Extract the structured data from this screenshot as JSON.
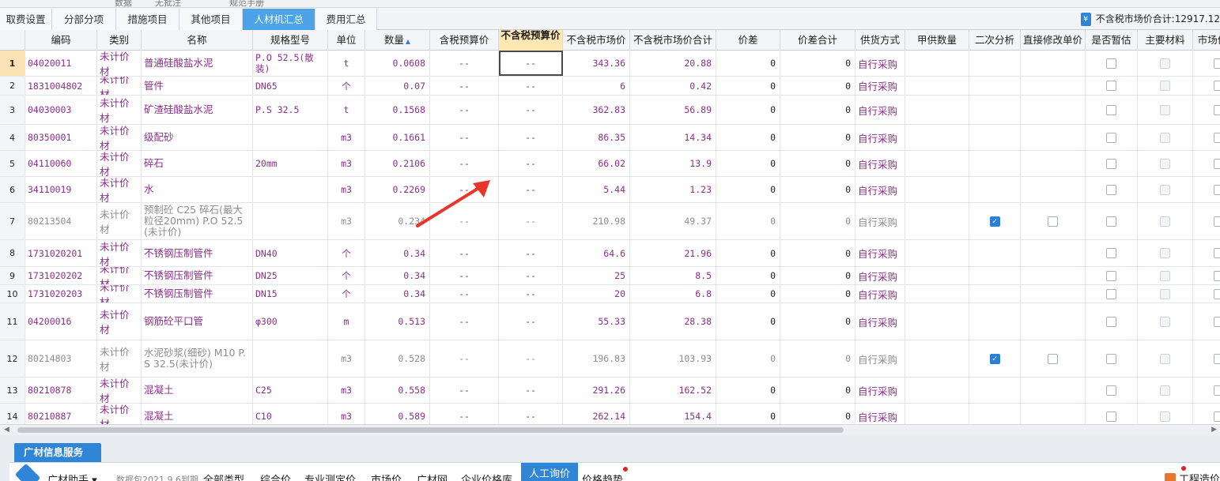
{
  "top_strip": {
    "items": [
      "数据",
      "无批注",
      "规范手册"
    ]
  },
  "tabs": [
    {
      "label": "取费设置",
      "active": false
    },
    {
      "label": "分部分项",
      "active": false
    },
    {
      "label": "措施项目",
      "active": false
    },
    {
      "label": "其他项目",
      "active": false
    },
    {
      "label": "人材机汇总",
      "active": true
    },
    {
      "label": "费用汇总",
      "active": false
    }
  ],
  "summary": {
    "icon": "yen-icon",
    "label": "不含税市场价合计:",
    "value": "12917.12"
  },
  "columns": [
    "",
    "编码",
    "类别",
    "名称",
    "规格型号",
    "单位",
    "数量",
    "含税预算价",
    "不含税预算价",
    "不含税市场价",
    "不含税市场价合计",
    "价差",
    "价差合计",
    "供货方式",
    "甲供数量",
    "二次分析",
    "直接修改单价",
    "是否暂估",
    "主要材料",
    "市场价"
  ],
  "rows": [
    {
      "no": "1",
      "code": "04020011",
      "type": "未计价材",
      "name": "普通硅酸盐水泥",
      "spec": "P.O 52.5(散装)",
      "unit": "t",
      "qty": "0.0608",
      "tax_budget": "--",
      "notax_budget": "--",
      "market": "343.36",
      "market_total": "20.88",
      "diff": "0",
      "diff_total": "0",
      "supply": "自行采购",
      "grey": false,
      "analysis": null,
      "direct": null
    },
    {
      "no": "2",
      "code": "1831004802",
      "type": "未计价材",
      "name": "管件",
      "spec": "DN65",
      "unit": "个",
      "qty": "0.07",
      "tax_budget": "--",
      "notax_budget": "--",
      "market": "6",
      "market_total": "0.42",
      "diff": "0",
      "diff_total": "0",
      "supply": "自行采购",
      "grey": false,
      "analysis": null,
      "direct": null
    },
    {
      "no": "3",
      "code": "04030003",
      "type": "未计价材",
      "name": "矿渣硅酸盐水泥",
      "spec": "P.S 32.5",
      "unit": "t",
      "qty": "0.1568",
      "tax_budget": "--",
      "notax_budget": "--",
      "market": "362.83",
      "market_total": "56.89",
      "diff": "0",
      "diff_total": "0",
      "supply": "自行采购",
      "grey": false,
      "analysis": null,
      "direct": null
    },
    {
      "no": "4",
      "code": "80350001",
      "type": "未计价材",
      "name": "级配砂",
      "spec": "",
      "unit": "m3",
      "qty": "0.1661",
      "tax_budget": "--",
      "notax_budget": "--",
      "market": "86.35",
      "market_total": "14.34",
      "diff": "0",
      "diff_total": "0",
      "supply": "自行采购",
      "grey": false,
      "analysis": null,
      "direct": null
    },
    {
      "no": "5",
      "code": "04110060",
      "type": "未计价材",
      "name": "碎石",
      "spec": "20mm",
      "unit": "m3",
      "qty": "0.2106",
      "tax_budget": "--",
      "notax_budget": "--",
      "market": "66.02",
      "market_total": "13.9",
      "diff": "0",
      "diff_total": "0",
      "supply": "自行采购",
      "grey": false,
      "analysis": null,
      "direct": null
    },
    {
      "no": "6",
      "code": "34110019",
      "type": "未计价材",
      "name": "水",
      "spec": "",
      "unit": "m3",
      "qty": "0.2269",
      "tax_budget": "--",
      "notax_budget": "--",
      "market": "5.44",
      "market_total": "1.23",
      "diff": "0",
      "diff_total": "0",
      "supply": "自行采购",
      "grey": false,
      "analysis": null,
      "direct": null
    },
    {
      "no": "7",
      "code": "80213504",
      "type": "未计价材",
      "name": "预制砼 C25 碎石(最大粒径20mm) P.O 52.5(未计价)",
      "spec": "",
      "unit": "m3",
      "qty": "0.234",
      "tax_budget": "--",
      "notax_budget": "--",
      "market": "210.98",
      "market_total": "49.37",
      "diff": "0",
      "diff_total": "0",
      "supply": "自行采购",
      "grey": true,
      "analysis": true,
      "direct": false
    },
    {
      "no": "8",
      "code": "1731020201",
      "type": "未计价材",
      "name": "不锈钢压制管件",
      "spec": "DN40",
      "unit": "个",
      "qty": "0.34",
      "tax_budget": "--",
      "notax_budget": "--",
      "market": "64.6",
      "market_total": "21.96",
      "diff": "0",
      "diff_total": "0",
      "supply": "自行采购",
      "grey": false,
      "analysis": null,
      "direct": null
    },
    {
      "no": "9",
      "code": "1731020202",
      "type": "未计价材",
      "name": "不锈钢压制管件",
      "spec": "DN25",
      "unit": "个",
      "qty": "0.34",
      "tax_budget": "--",
      "notax_budget": "--",
      "market": "25",
      "market_total": "8.5",
      "diff": "0",
      "diff_total": "0",
      "supply": "自行采购",
      "grey": false,
      "analysis": null,
      "direct": null
    },
    {
      "no": "10",
      "code": "1731020203",
      "type": "未计价材",
      "name": "不锈钢压制管件",
      "spec": "DN15",
      "unit": "个",
      "qty": "0.34",
      "tax_budget": "--",
      "notax_budget": "--",
      "market": "20",
      "market_total": "6.8",
      "diff": "0",
      "diff_total": "0",
      "supply": "自行采购",
      "grey": false,
      "analysis": null,
      "direct": null
    },
    {
      "no": "11",
      "code": "04200016",
      "type": "未计价材",
      "name": "钢筋砼平口管",
      "spec": "φ300",
      "unit": "m",
      "qty": "0.513",
      "tax_budget": "--",
      "notax_budget": "--",
      "market": "55.33",
      "market_total": "28.38",
      "diff": "0",
      "diff_total": "0",
      "supply": "自行采购",
      "grey": false,
      "analysis": null,
      "direct": null
    },
    {
      "no": "12",
      "code": "80214803",
      "type": "未计价材",
      "name": "水泥砂浆(细砂) M10 P.S 32.5(未计价)",
      "spec": "",
      "unit": "m3",
      "qty": "0.528",
      "tax_budget": "--",
      "notax_budget": "--",
      "market": "196.83",
      "market_total": "103.93",
      "diff": "0",
      "diff_total": "0",
      "supply": "自行采购",
      "grey": true,
      "analysis": true,
      "direct": false
    },
    {
      "no": "13",
      "code": "80210878",
      "type": "未计价材",
      "name": "混凝土",
      "spec": "C25",
      "unit": "m3",
      "qty": "0.558",
      "tax_budget": "--",
      "notax_budget": "--",
      "market": "291.26",
      "market_total": "162.52",
      "diff": "0",
      "diff_total": "0",
      "supply": "自行采购",
      "grey": false,
      "analysis": null,
      "direct": null
    },
    {
      "no": "14",
      "code": "80210887",
      "type": "未计价材",
      "name": "混凝土",
      "spec": "C10",
      "unit": "m3",
      "qty": "0.589",
      "tax_budget": "--",
      "notax_budget": "--",
      "market": "262.14",
      "market_total": "154.4",
      "diff": "0",
      "diff_total": "0",
      "supply": "自行采购",
      "grey": false,
      "analysis": null,
      "direct": null
    }
  ],
  "service": {
    "tab": "广材信息服务",
    "helper": "广材助手",
    "version": "数据包2021.9.6到期",
    "links": [
      {
        "label": "全部类型",
        "active": false
      },
      {
        "label": "综合价",
        "active": false
      },
      {
        "label": "专业测定价",
        "active": false
      },
      {
        "label": "市场价",
        "active": false
      },
      {
        "label": "广材网",
        "active": false
      },
      {
        "label": "企业价格库",
        "active": false
      },
      {
        "label": "人工询价",
        "active": true
      },
      {
        "label": "价格趋势",
        "active": false
      }
    ],
    "right": "工程造价"
  },
  "colors": {
    "accent": "#2f86d6",
    "tab_active": "#4da3e8",
    "cell_text": "#8a2f8a",
    "grey_text": "#8d8d8d",
    "arrow": "#e8362a"
  }
}
